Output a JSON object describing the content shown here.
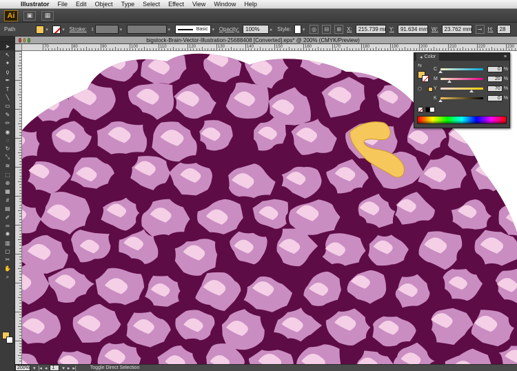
{
  "menubar": {
    "apple": "",
    "items": [
      "Illustrator",
      "File",
      "Edit",
      "Object",
      "Type",
      "Select",
      "Effect",
      "View",
      "Window",
      "Help"
    ]
  },
  "appbar": {
    "logo": "Ai"
  },
  "controlbar": {
    "selection_type": "Path",
    "stroke_label": "Stroke:",
    "brush_label": "Basic",
    "opacity_label": "Opacity:",
    "opacity_value": "100%",
    "style_label": "Style:",
    "x_label": "X:",
    "x_value": "215.739 mr",
    "y_label": "Y:",
    "y_value": "91.634 mm",
    "w_label": "W:",
    "w_value": "23.762 mm",
    "h_label": "H:",
    "h_value": "28"
  },
  "document": {
    "title": "bigstock-Brain-Vector-Illustration-25688408 [Converted].eps* @ 200% (CMYK/Preview)"
  },
  "ruler": {
    "top_labels": [
      "70",
      "80",
      "90",
      "100",
      "110",
      "120",
      "130",
      "140",
      "150",
      "160",
      "170",
      "180",
      "190",
      "200",
      "210",
      "220",
      "230"
    ]
  },
  "color_panel": {
    "tab": "Color",
    "channels": [
      {
        "label": "C",
        "value": "0",
        "unit": "%",
        "level": 0,
        "gradient": "linear-gradient(to right, #f6f0c8, #00a8e0)"
      },
      {
        "label": "M",
        "value": "20",
        "unit": "%",
        "level": 0.2,
        "gradient": "linear-gradient(to right, #f6f0c8, #e8008a)"
      },
      {
        "label": "Y",
        "value": "70",
        "unit": "%",
        "level": 0.7,
        "gradient": "linear-gradient(to right, #f6d8e0, #f6d000)"
      },
      {
        "label": "K",
        "value": "0",
        "unit": "%",
        "level": 0,
        "gradient": "linear-gradient(to right, #f6c75a, #000000)"
      }
    ]
  },
  "status": {
    "zoom": "200%",
    "artboard": "1",
    "text": "Toggle Direct Selection"
  },
  "colors": {
    "fill": "#f6c75a",
    "brain_outline": "#5e0c45",
    "brain_mid": "#c98dc2",
    "brain_light": "#f4cfe6"
  },
  "tools": [
    "selection-tool",
    "direct-selection-tool",
    "magic-wand-tool",
    "lasso-tool",
    "pen-tool",
    "type-tool",
    "line-tool",
    "rectangle-tool",
    "paintbrush-tool",
    "pencil-tool",
    "blob-brush-tool",
    "eraser-tool",
    "rotate-tool",
    "scale-tool",
    "width-tool",
    "free-transform-tool",
    "shape-builder-tool",
    "perspective-grid-tool",
    "mesh-tool",
    "gradient-tool",
    "eyedropper-tool",
    "blend-tool",
    "symbol-sprayer-tool",
    "column-graph-tool",
    "artboard-tool",
    "slice-tool",
    "hand-tool",
    "zoom-tool"
  ]
}
